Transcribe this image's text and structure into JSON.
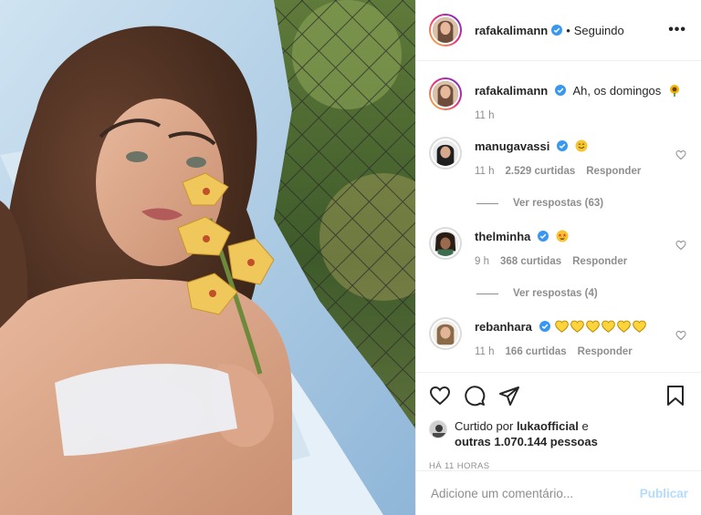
{
  "post": {
    "photo_icon": "portrait-photo",
    "author": "rafakalimann",
    "follow_dot": "•",
    "follow_status": "Seguindo",
    "more_icon": "•••"
  },
  "caption": {
    "username": "rafakalimann",
    "text": "Ah, os domingos",
    "emoji": "sunflower",
    "time": "11 h"
  },
  "comments": [
    {
      "username": "manugavassi",
      "verified": true,
      "emoji": "smiling-face",
      "time": "11 h",
      "likes": "2.529 curtidas",
      "reply": "Responder",
      "view_replies": "Ver respostas (63)"
    },
    {
      "username": "thelminha",
      "verified": true,
      "emoji": "star-struck-face",
      "time": "9 h",
      "likes": "368 curtidas",
      "reply": "Responder",
      "view_replies": "Ver respostas (4)"
    },
    {
      "username": "rebanhara",
      "verified": true,
      "emoji": "yellow-heart x6",
      "time": "11 h",
      "likes": "166 curtidas",
      "reply": "Responder"
    }
  ],
  "liked_by": {
    "prefix": "Curtido por",
    "user": "lukaofficial",
    "conj": "e",
    "others": "outras 1.070.144 pessoas"
  },
  "timestamp": "Há 11 horas",
  "add_comment": {
    "placeholder": "Adicione um comentário...",
    "publish": "Publicar"
  },
  "colors": {
    "verified": "#3897f0",
    "muted": "#8e8e8e",
    "publish_disabled": "#b3dbff",
    "text": "#262626"
  }
}
